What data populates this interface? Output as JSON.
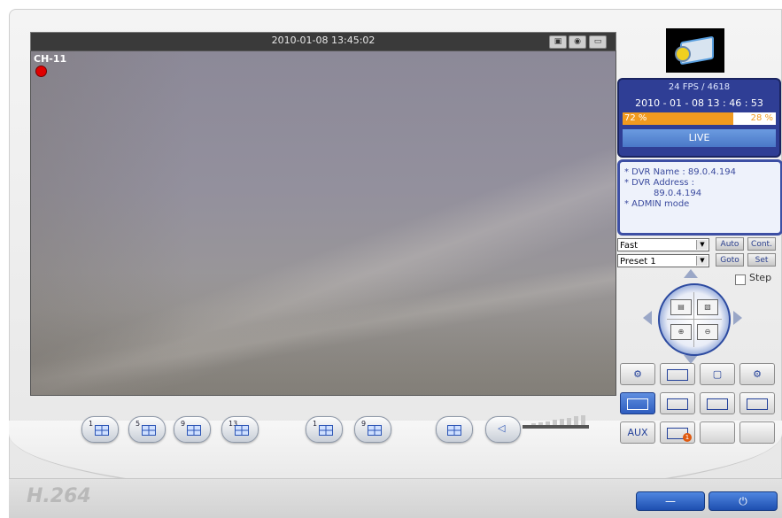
{
  "video": {
    "timestamp": "2010-01-08 13:45:02",
    "channel_label": "CH-11"
  },
  "status": {
    "fps": "24 FPS / 4618",
    "datetime": "2010 - 01 - 08  13 : 46 : 53",
    "disk_used": "72 %",
    "disk_used_fraction": 0.72,
    "disk_free": "28 %",
    "mode": "LIVE"
  },
  "info": {
    "dvr_name": "* DVR Name : 89.0.4.194",
    "dvr_address_label": "* DVR Address :",
    "dvr_address_value": "89.0.4.194",
    "admin": "* ADMIN mode"
  },
  "ptz": {
    "speed_select": "Fast",
    "preset_select": "Preset 1",
    "auto_label": "Auto",
    "cont_label": "Cont.",
    "goto_label": "Goto",
    "set_label": "Set",
    "step_label": "Step"
  },
  "layout_buttons": [
    {
      "num": "1"
    },
    {
      "num": "5"
    },
    {
      "num": "9"
    },
    {
      "num": "13"
    },
    {
      "num": "1"
    },
    {
      "num": "9"
    }
  ],
  "tools": {
    "aux_label": "AUX",
    "badge": "1"
  },
  "brand": {
    "logo": "H.264"
  },
  "window": {
    "minimize_label": "—",
    "power_label": "⏻"
  },
  "colors": {
    "panel_blue": "#2f3e95",
    "disk_orange": "#f19a1f",
    "rec_red": "#e00000"
  }
}
